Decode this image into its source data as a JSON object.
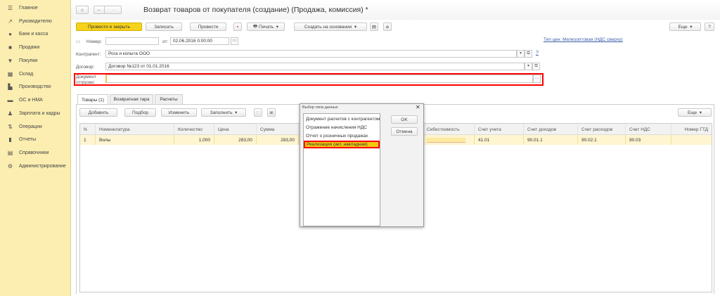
{
  "sidebar": {
    "items": [
      {
        "label": "Главное",
        "icon": "menu-icon"
      },
      {
        "label": "Руководителю",
        "icon": "trend-icon"
      },
      {
        "label": "Банк и касса",
        "icon": "coin-icon"
      },
      {
        "label": "Продажи",
        "icon": "bag-icon"
      },
      {
        "label": "Покупки",
        "icon": "cart-icon"
      },
      {
        "label": "Склад",
        "icon": "warehouse-icon"
      },
      {
        "label": "Производство",
        "icon": "factory-icon"
      },
      {
        "label": "ОС и НМА",
        "icon": "truck-icon"
      },
      {
        "label": "Зарплата и кадры",
        "icon": "person-icon"
      },
      {
        "label": "Операции",
        "icon": "operations-icon"
      },
      {
        "label": "Отчеты",
        "icon": "chart-icon"
      },
      {
        "label": "Справочники",
        "icon": "book-icon"
      },
      {
        "label": "Администрирование",
        "icon": "gear-icon"
      }
    ]
  },
  "header": {
    "title": "Возврат товаров от покупателя (создание) (Продажа, комиссия) *"
  },
  "toolbar": {
    "post_close": "Провести и закрыть",
    "save": "Записать",
    "post": "Провести",
    "print": "Печать",
    "create_based": "Создать на основании",
    "more": "Еще",
    "help": "?"
  },
  "price_type_link": "Тип цен: Мелкооптовая (НДС сверху)",
  "form": {
    "number_label": "Номер:",
    "number_value": "",
    "date_label": "от:",
    "date_value": "02.06.2016  0:00:00",
    "counterparty_label": "Контрагент:",
    "counterparty_value": "Рога и копыта ООО",
    "contract_label": "Договор:",
    "contract_value": "Договор №123 от 01.01.2016",
    "document_label": "Документ отгрузки:",
    "document_value": "",
    "help": "?"
  },
  "tabs": [
    {
      "label": "Товары (1)",
      "active": true
    },
    {
      "label": "Возвратная тара"
    },
    {
      "label": "Расчеты"
    }
  ],
  "table_toolbar": {
    "add": "Добавить",
    "pick": "Подбор",
    "edit": "Изменить",
    "fill": "Заполнить",
    "more": "Еще"
  },
  "table": {
    "columns": [
      "N",
      "Номенклатура",
      "Количество",
      "Цена",
      "Сумма",
      "Себестоимость",
      "Счет учета",
      "Счет доходов",
      "Счет расходов",
      "Счет НДС",
      "Номер ГТД"
    ],
    "rows": [
      {
        "n": "1",
        "item": "Вилы",
        "qty": "1,000",
        "price": "283,00",
        "sum": "283,00",
        "cost": "",
        "account": "41.01",
        "income": "90.01.1",
        "expense": "90.02.1",
        "vat": "90.03",
        "gtd": ""
      }
    ]
  },
  "dialog": {
    "title": "Выбор типа данных",
    "items": [
      "Документ расчетов с контрагентом",
      "Отражение начисления НДС",
      "Отчет о розничных продажах",
      "Реализация (акт, накладная)"
    ],
    "selected_index": 3,
    "ok": "OK",
    "cancel": "Отмена"
  },
  "colors": {
    "sidebar": "#fbeeb0",
    "primary_button": "#f5d21c",
    "highlight": "#ff0000",
    "row_selected": "#fff5d0"
  }
}
